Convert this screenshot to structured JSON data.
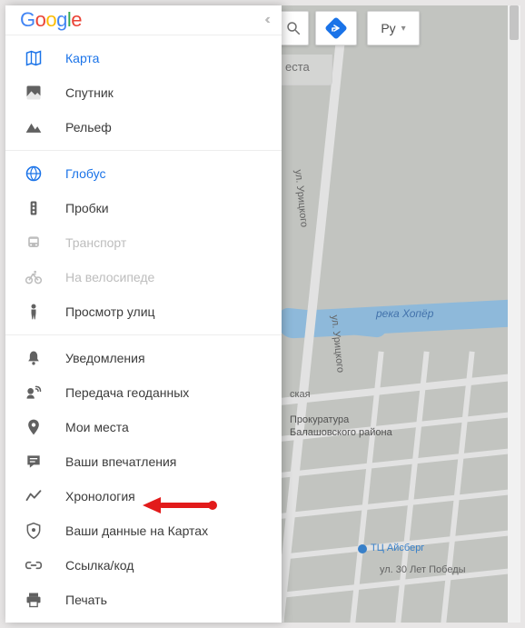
{
  "logo": {
    "g1": "G",
    "g2": "o",
    "g3": "o",
    "g4": "g",
    "g5": "l",
    "g6": "e"
  },
  "collapse_glyph": "‹‹",
  "toolbar": {
    "search_hint": "еста",
    "lang_label": "Ру",
    "caret": "▾"
  },
  "groups": [
    {
      "items": [
        {
          "id": "map",
          "label": "Карта",
          "icon": "map",
          "state": "active"
        },
        {
          "id": "satellite",
          "label": "Спутник",
          "icon": "satellite",
          "state": "normal"
        },
        {
          "id": "terrain",
          "label": "Рельеф",
          "icon": "terrain",
          "state": "normal"
        }
      ]
    },
    {
      "items": [
        {
          "id": "globe",
          "label": "Глобус",
          "icon": "globe",
          "state": "active"
        },
        {
          "id": "traffic",
          "label": "Пробки",
          "icon": "traffic",
          "state": "normal"
        },
        {
          "id": "transit",
          "label": "Транспорт",
          "icon": "transit",
          "state": "disabled"
        },
        {
          "id": "cycling",
          "label": "На велосипеде",
          "icon": "bike",
          "state": "disabled"
        },
        {
          "id": "streetview",
          "label": "Просмотр улиц",
          "icon": "pegman",
          "state": "normal"
        }
      ]
    },
    {
      "items": [
        {
          "id": "notifications",
          "label": "Уведомления",
          "icon": "bell",
          "state": "normal"
        },
        {
          "id": "location-sharing",
          "label": "Передача геоданных",
          "icon": "share-loc",
          "state": "normal"
        },
        {
          "id": "your-places",
          "label": "Мои места",
          "icon": "pin",
          "state": "normal"
        },
        {
          "id": "contributions",
          "label": "Ваши впечатления",
          "icon": "review",
          "state": "normal"
        },
        {
          "id": "timeline",
          "label": "Хронология",
          "icon": "timeline",
          "state": "normal"
        },
        {
          "id": "your-data",
          "label": "Ваши данные на Картах",
          "icon": "shield",
          "state": "normal"
        },
        {
          "id": "share-embed",
          "label": "Ссылка/код",
          "icon": "link",
          "state": "normal"
        },
        {
          "id": "print",
          "label": "Печать",
          "icon": "print",
          "state": "normal"
        }
      ]
    }
  ],
  "map_labels": {
    "street1": "ул. Урицкого",
    "street2": "ул. Урицкого",
    "river": "река Хопёр",
    "poi1_a": "Прокуратура",
    "poi1_b": "Балашовского района",
    "poi2": "ТЦ Айсберг",
    "street3": "ская",
    "street4": "ул. 30 Лет Победы"
  }
}
